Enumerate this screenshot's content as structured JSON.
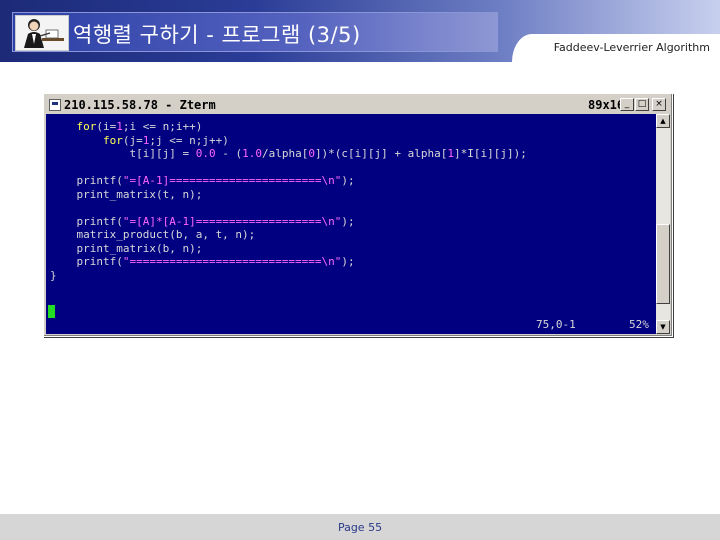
{
  "slide": {
    "title": "역행렬 구하기 - 프로그램 (3/5)",
    "subtitle": "Faddeev-Leverrier Algorithm",
    "page_label": "Page 55"
  },
  "terminal": {
    "window_title": "210.115.58.78 - Zterm",
    "dims": "89x16",
    "buttons": {
      "minimize": "_",
      "maximize": "□",
      "close": "×"
    },
    "code_lines": [
      [
        {
          "t": "    "
        },
        {
          "t": "for",
          "c": "kw"
        },
        {
          "t": "(i="
        },
        {
          "t": "1",
          "c": "num"
        },
        {
          "t": ";i <= n;i++)"
        }
      ],
      [
        {
          "t": "        "
        },
        {
          "t": "for",
          "c": "kw"
        },
        {
          "t": "(j="
        },
        {
          "t": "1",
          "c": "num"
        },
        {
          "t": ";j <= n;j++)"
        }
      ],
      [
        {
          "t": "            t[i][j] = "
        },
        {
          "t": "0.0",
          "c": "num"
        },
        {
          "t": " - ("
        },
        {
          "t": "1.0",
          "c": "num"
        },
        {
          "t": "/alpha["
        },
        {
          "t": "0",
          "c": "num"
        },
        {
          "t": "])*(c[i][j] + alpha["
        },
        {
          "t": "1",
          "c": "num"
        },
        {
          "t": "]*I[i][j]);"
        }
      ],
      [
        {
          "t": ""
        }
      ],
      [
        {
          "t": "    printf("
        },
        {
          "t": "\"=[A-1]=======================\\n\"",
          "c": "str"
        },
        {
          "t": ");"
        }
      ],
      [
        {
          "t": "    print_matrix(t, n);"
        }
      ],
      [
        {
          "t": ""
        }
      ],
      [
        {
          "t": "    printf("
        },
        {
          "t": "\"=[A]*[A-1]===================\\n\"",
          "c": "str"
        },
        {
          "t": ");"
        }
      ],
      [
        {
          "t": "    matrix_product(b, a, t, n);"
        }
      ],
      [
        {
          "t": "    print_matrix(b, n);"
        }
      ],
      [
        {
          "t": "    printf("
        },
        {
          "t": "\"=============================\\n\"",
          "c": "str"
        },
        {
          "t": ");"
        }
      ],
      [
        {
          "t": "}"
        }
      ]
    ],
    "status_position": "75,0-1",
    "status_percent": "52%"
  }
}
